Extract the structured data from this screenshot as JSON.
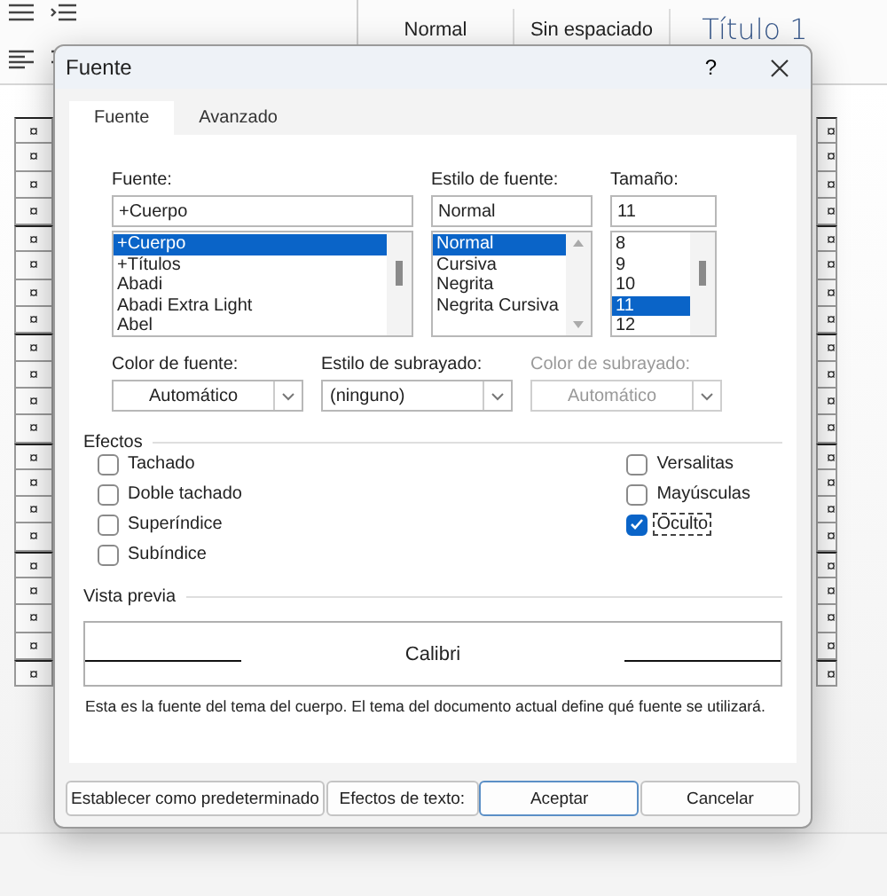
{
  "ribbon": {
    "styles": [
      {
        "label": "Normal",
        "kind": "plain"
      },
      {
        "label": "Sin espaciado",
        "kind": "plain"
      },
      {
        "label": "Título 1",
        "kind": "heading"
      }
    ]
  },
  "document": {
    "left_marks": [
      "¤",
      "¤",
      "¤",
      "¤",
      "¤",
      "¤",
      "¤",
      "¤",
      "¤",
      "¤",
      "¤",
      "¤",
      "¤",
      "¤",
      "¤",
      "¤",
      "¤",
      "¤",
      "¤",
      "¤",
      "¤"
    ],
    "right_marks": [
      "¤",
      "¤",
      "¤",
      "¤",
      "¤",
      "¤",
      "¤",
      "¤",
      "¤",
      "¤",
      "¤",
      "¤",
      "¤",
      "¤",
      "¤",
      "¤",
      "¤",
      "¤",
      "¤",
      "¤",
      "¤"
    ]
  },
  "dialog": {
    "title": "Fuente",
    "help": "?",
    "tabs": [
      {
        "label": "Fuente",
        "selected": true
      },
      {
        "label": "Avanzado",
        "selected": false
      }
    ],
    "font": {
      "label": "Fuente:",
      "value": "+Cuerpo",
      "kind": "thumb",
      "options": [
        {
          "label": "+Cuerpo",
          "selected": true
        },
        {
          "label": "+Títulos",
          "selected": false
        },
        {
          "label": "Abadi",
          "selected": false
        },
        {
          "label": "Abadi Extra Light",
          "selected": false
        },
        {
          "label": "Abel",
          "selected": false
        }
      ]
    },
    "style": {
      "label": "Estilo de fuente:",
      "value": "Normal",
      "kind": "arrows",
      "options": [
        {
          "label": "Normal",
          "selected": true
        },
        {
          "label": "Cursiva",
          "selected": false
        },
        {
          "label": "Negrita",
          "selected": false
        },
        {
          "label": "Negrita Cursiva",
          "selected": false
        }
      ]
    },
    "size": {
      "label": "Tamaño:",
      "value": "11",
      "kind": "thumb",
      "options": [
        {
          "label": "8",
          "selected": false
        },
        {
          "label": "9",
          "selected": false
        },
        {
          "label": "10",
          "selected": false
        },
        {
          "label": "11",
          "selected": true
        },
        {
          "label": "12",
          "selected": false
        }
      ]
    },
    "combos": [
      {
        "label": "Color de fuente:",
        "value": "Automático",
        "kind": "color",
        "disabled": false
      },
      {
        "label": "Estilo de subrayado:",
        "value": "(ninguno)",
        "kind": "style",
        "disabled": false
      },
      {
        "label": "Color de subrayado:",
        "value": "Automático",
        "kind": "color",
        "disabled": true
      }
    ],
    "effects": {
      "title": "Efectos",
      "left": [
        {
          "label": "Tachado",
          "checked": false,
          "focused": false
        },
        {
          "label": "Doble tachado",
          "checked": false,
          "focused": false
        },
        {
          "label": "Superíndice",
          "checked": false,
          "focused": false
        },
        {
          "label": "Subíndice",
          "checked": false,
          "focused": false
        }
      ],
      "right": [
        {
          "label": "Versalitas",
          "checked": false,
          "focused": false
        },
        {
          "label": "Mayúsculas",
          "checked": false,
          "focused": false
        },
        {
          "label": "Oculto",
          "checked": true,
          "focused": true
        }
      ]
    },
    "preview": {
      "title": "Vista previa",
      "sample": "Calibri",
      "description": "Esta es la fuente del tema del cuerpo. El tema del documento actual define qué fuente se utilizará."
    },
    "buttons": [
      {
        "label": "Establecer como predeterminado",
        "default": false
      },
      {
        "label": "Efectos de texto:",
        "default": false
      },
      {
        "label": "Aceptar",
        "default": true
      },
      {
        "label": "Cancelar",
        "default": false
      }
    ]
  }
}
